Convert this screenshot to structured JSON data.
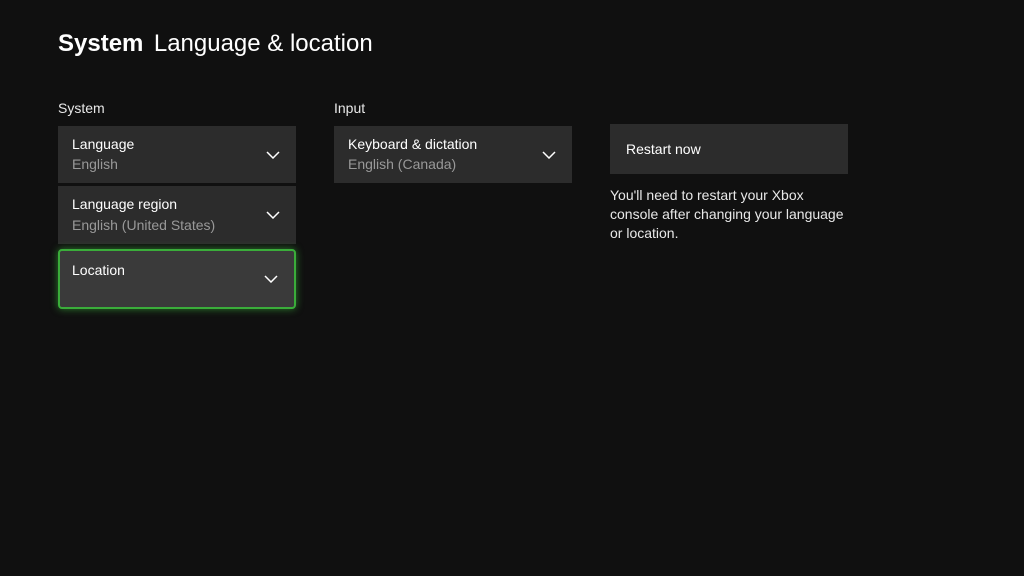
{
  "header": {
    "prefix": "System",
    "title": "Language & location"
  },
  "systemSection": {
    "label": "System",
    "language": {
      "label": "Language",
      "value": "English"
    },
    "languageRegion": {
      "label": "Language region",
      "value": "English (United States)"
    },
    "location": {
      "label": "Location",
      "value": ""
    }
  },
  "inputSection": {
    "label": "Input",
    "keyboard": {
      "label": "Keyboard & dictation",
      "value": "English (Canada)"
    }
  },
  "actionSection": {
    "restartLabel": "Restart now",
    "infoText": "You'll need to restart your Xbox console after changing your language or location."
  }
}
